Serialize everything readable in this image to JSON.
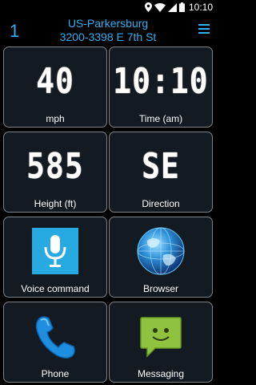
{
  "status_bar": {
    "time": "10:10",
    "icons": [
      "location-icon",
      "wifi-icon",
      "signal-icon",
      "battery-icon"
    ]
  },
  "header": {
    "number": "1",
    "location_line1": "US-Parkersburg",
    "location_line2": "3200-3398 E 7th St",
    "menu_icon": "hamburger-menu-icon"
  },
  "tiles": {
    "speed": {
      "value": "40",
      "label": "mph"
    },
    "time": {
      "value": "10:10",
      "label": "Time (am)"
    },
    "height": {
      "value": "585",
      "label": "Height (ft)"
    },
    "direction": {
      "value": "SE",
      "label": "Direction"
    },
    "voice": {
      "label": "Voice command",
      "icon": "microphone-icon"
    },
    "browser": {
      "label": "Browser",
      "icon": "globe-icon"
    },
    "phone": {
      "label": "Phone",
      "icon": "phone-handset-icon"
    },
    "messaging": {
      "label": "Messaging",
      "icon": "message-bubble-icon"
    }
  },
  "colors": {
    "accent": "#2fb0f0",
    "tile_bg": "#141a21",
    "tile_border": "#7e8388"
  }
}
